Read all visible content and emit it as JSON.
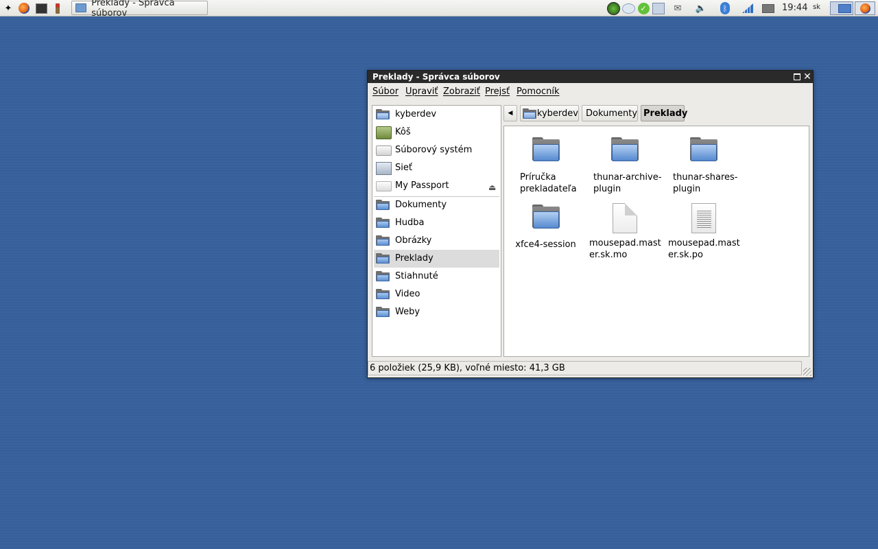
{
  "panel": {
    "launchers": [
      "xfce-mouse-icon",
      "firefox-icon",
      "terminal-icon",
      "settings-brush-icon"
    ],
    "task_button": "Preklady - Správca súborov",
    "tray_icons": [
      "globe-icon",
      "chat-icon",
      "check-update-icon",
      "network-manager-icon",
      "mail-icon",
      "volume-icon",
      "bluetooth-icon",
      "signal-icon",
      "envelope-icon"
    ],
    "clock": "19:44",
    "keyboard_layout": "sk"
  },
  "window": {
    "title": "Preklady - Správca súborov",
    "menu": [
      "Súbor",
      "Upraviť",
      "Zobraziť",
      "Prejsť",
      "Pomocník"
    ]
  },
  "sidebar": {
    "devices": [
      {
        "label": "kyberdev",
        "icon": "home-folder-icon"
      },
      {
        "label": "Kôš",
        "icon": "trash-icon"
      },
      {
        "label": "Súborový systém",
        "icon": "drive-icon"
      },
      {
        "label": "Sieť",
        "icon": "network-icon"
      },
      {
        "label": "My Passport",
        "icon": "external-drive-icon"
      }
    ],
    "places": [
      "Dokumenty",
      "Hudba",
      "Obrázky",
      "Preklady",
      "Stiahnuté",
      "Video",
      "Weby"
    ],
    "selected": "Preklady"
  },
  "pathbar": {
    "segments": [
      "kyberdev",
      "Dokumenty",
      "Preklady"
    ],
    "active": "Preklady"
  },
  "files": [
    {
      "name": "Príručka prekladateľa",
      "type": "folder"
    },
    {
      "name": "thunar-archive-plugin",
      "type": "folder"
    },
    {
      "name": "thunar-shares-plugin",
      "type": "folder"
    },
    {
      "name": "xfce4-session",
      "type": "folder"
    },
    {
      "name": "mousepad.master.sk.mo",
      "type": "binary-file"
    },
    {
      "name": "mousepad.master.sk.po",
      "type": "text-file"
    }
  ],
  "statusbar": {
    "text": "6 položiek (25,9 KB), voľné miesto: 41,3 GB"
  },
  "colors": {
    "desktop": "#37609a",
    "titlebar": "#2a2a2a",
    "folder_blue": "#5d8fd2",
    "selection": "#dcdcdc"
  }
}
